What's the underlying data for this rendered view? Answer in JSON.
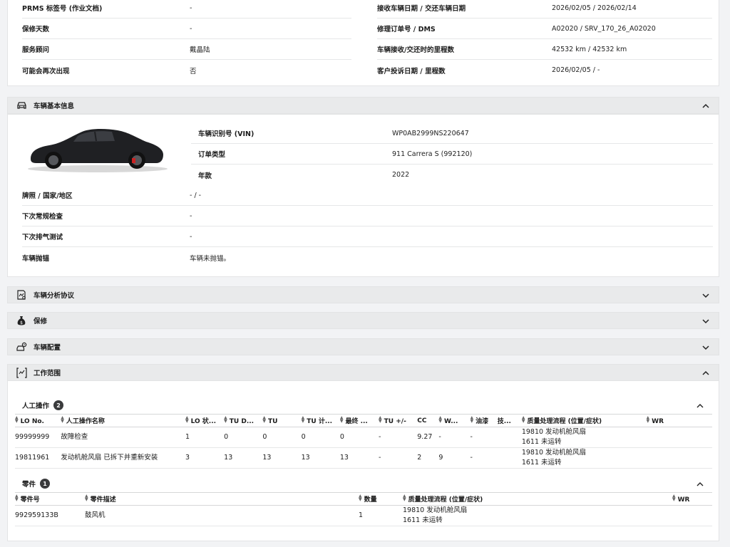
{
  "order_info": {
    "left": [
      {
        "label": "PRMS 标签号 (作业文档)",
        "value": "-"
      },
      {
        "label": "保修天数",
        "value": "-"
      },
      {
        "label": "服务顾问",
        "value": "戴晶陆"
      },
      {
        "label": "可能会再次出现",
        "value": "否"
      }
    ],
    "right": [
      {
        "label": "接收车辆日期 / 交还车辆日期",
        "value": "2026/02/05 / 2026/02/14"
      },
      {
        "label": "修理订单号 / DMS",
        "value": "A02020 / SRV_170_26_A02020"
      },
      {
        "label": "车辆接收/交还时的里程数",
        "value": "42532 km / 42532 km"
      },
      {
        "label": "客户投诉日期 / 里程数",
        "value": "2026/02/05 / -"
      }
    ]
  },
  "sections": {
    "vehicle_basic": {
      "title": "车辆基本信息",
      "icon": "car-icon",
      "expanded": true
    },
    "vehicle_analysis": {
      "title": "车辆分析协议",
      "icon": "analysis-protocol-icon",
      "expanded": false
    },
    "warranty": {
      "title": "保修",
      "icon": "money-bag-icon",
      "expanded": false
    },
    "vehicle_config": {
      "title": "车辆配置",
      "icon": "car-config-icon",
      "expanded": false
    },
    "work_scope": {
      "title": "工作范围",
      "icon": "work-scope-icon",
      "expanded": true
    }
  },
  "vehicle": {
    "top": [
      {
        "label": "车辆识别号 (VIN)",
        "value": "WP0AB2999NS220647"
      },
      {
        "label": "订单类型",
        "value": "911 Carrera S (992120)"
      },
      {
        "label": "年款",
        "value": "2022"
      }
    ],
    "lower": [
      {
        "label": "牌照 / 国家/地区",
        "value": "- / -"
      },
      {
        "label": "下次常规检查",
        "value": "-"
      },
      {
        "label": "下次排气测试",
        "value": "-"
      },
      {
        "label": "车辆抛锚",
        "value": "车辆未抛锚。"
      }
    ]
  },
  "labor": {
    "title": "人工操作",
    "count": "2",
    "columns": [
      "LO No.",
      "人工操作名称",
      "LO 状...",
      "TU D...",
      "TU",
      "TU 计...",
      "最终 ...",
      "TU +/-",
      "CC",
      "W...",
      "油漆",
      "技...",
      "质量处理流程 (位置/症状)",
      "WR"
    ],
    "rows": [
      {
        "cells": [
          "99999999",
          "故障检查",
          "1",
          "0",
          "0",
          "0",
          "0",
          "-",
          "9.27",
          "-",
          "-",
          "",
          "19810 发动机舱风扇\n1611 未运转",
          ""
        ]
      },
      {
        "cells": [
          "19811961",
          "发动机舱风扇 已拆下并重新安装",
          "3",
          "13",
          "13",
          "13",
          "13",
          "-",
          "2",
          "9",
          "-",
          "",
          "19810 发动机舱风扇\n1611 未运转",
          ""
        ]
      }
    ]
  },
  "parts": {
    "title": "零件",
    "count": "1",
    "columns": [
      "零件号",
      "零件描述",
      "数量",
      "质量处理流程 (位置/症状)",
      "WR"
    ],
    "rows": [
      {
        "cells": [
          "992959133B",
          "鼓风机",
          "1",
          "19810 发动机舱风扇\n1611 未运转",
          ""
        ]
      }
    ]
  },
  "colors": {
    "header_bg": "#e9eaeb",
    "badge": "#3a3b3d",
    "page_bg": "#f2f3f5"
  }
}
